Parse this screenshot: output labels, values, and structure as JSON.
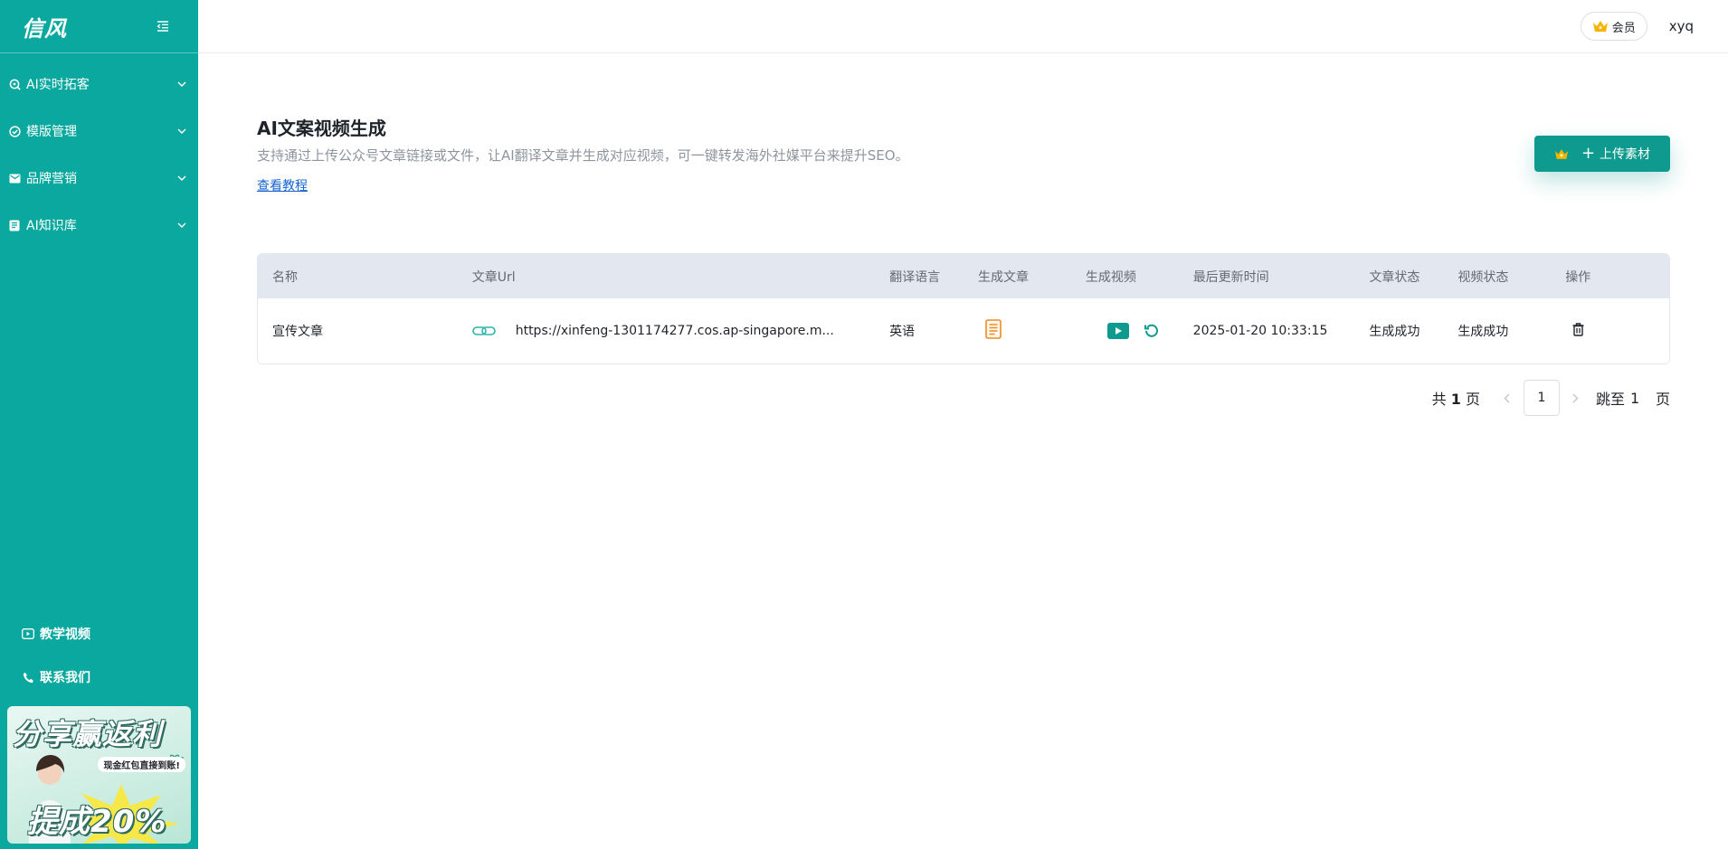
{
  "app": {
    "logo": "信风"
  },
  "sidebar": {
    "items": [
      {
        "label": "AI实时拓客",
        "icon": "search-icon"
      },
      {
        "label": "模版管理",
        "icon": "check-circle-icon"
      },
      {
        "label": "品牌营销",
        "icon": "mail-icon"
      },
      {
        "label": "AI知识库",
        "icon": "book-icon"
      }
    ],
    "bottom": [
      {
        "label": "教学视频",
        "icon": "video-icon"
      },
      {
        "label": "联系我们",
        "icon": "phone-icon"
      }
    ],
    "promo": {
      "title": "分享赢返利",
      "subtitle": "现金红包直接到账!",
      "rate": "提成20%"
    }
  },
  "topbar": {
    "member_label": "会员",
    "username": "xyq"
  },
  "page": {
    "title": "AI文案视频生成",
    "description": "支持通过上传公众号文章链接或文件，让AI翻译文章并生成对应视频，可一键转发海外社媒平台来提升SEO。",
    "tutorial_link": "查看教程",
    "upload_label": "上传素材"
  },
  "table": {
    "columns": [
      "名称",
      "文章Url",
      "翻译语言",
      "生成文章",
      "生成视频",
      "最后更新时间",
      "文章状态",
      "视频状态",
      "操作"
    ],
    "rows": [
      {
        "name": "宣传文章",
        "url": "https://xinfeng-1301174277.cos.ap-singapore.m...",
        "language": "英语",
        "updated": "2025-01-20 10:33:15",
        "article_status": "生成成功",
        "video_status": "生成成功"
      }
    ]
  },
  "pagination": {
    "total_prefix": "共",
    "total_pages": "1",
    "total_suffix": "页",
    "current_page": "1",
    "jump_label": "跳至",
    "jump_value": "1",
    "jump_suffix": "页"
  },
  "colors": {
    "brand": "#0aa89e",
    "button": "#0e9a8e",
    "link": "#1463d1",
    "accent_orange": "#f08a24",
    "crown": "#f5b400"
  }
}
